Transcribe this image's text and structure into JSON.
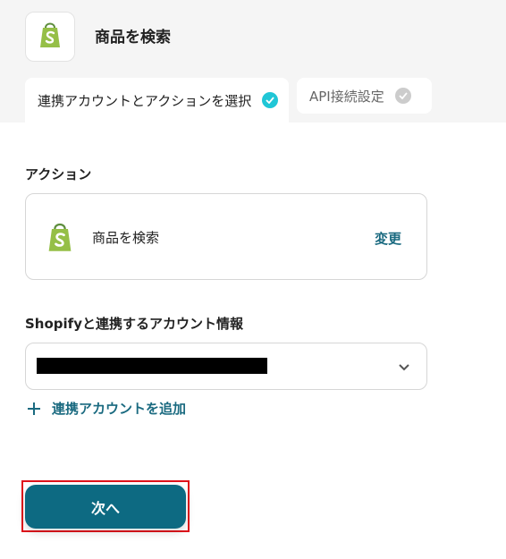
{
  "header": {
    "app_icon": "shopify-bag-icon",
    "title": "商品を検索"
  },
  "tabs": [
    {
      "label": "連携アカウントとアクションを選択",
      "status": "complete",
      "active": true
    },
    {
      "label": "API接続設定",
      "status": "incomplete",
      "active": false
    }
  ],
  "action_section": {
    "label": "アクション",
    "card": {
      "icon": "shopify-bag-icon",
      "label": "商品を検索",
      "change_label": "変更"
    }
  },
  "account_section": {
    "label": "Shopifyと連携するアカウント情報",
    "selected_value_redacted": true,
    "dropdown_icon": "chevron-down-icon",
    "add_account_label": "連携アカウントを追加",
    "add_icon": "plus-icon"
  },
  "footer": {
    "next_label": "次へ"
  },
  "colors": {
    "accent": "#0d6a82",
    "link": "#1a6a80",
    "check_active": "#20c6d6",
    "check_inactive": "#cccccc",
    "highlight_border": "#e0131b",
    "shopify_green": "#95bf47"
  }
}
